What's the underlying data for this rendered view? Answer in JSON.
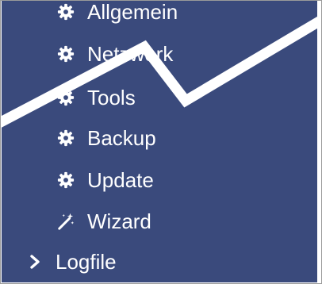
{
  "menu": {
    "items": [
      {
        "label": "Allgemein",
        "icon": "gear-icon"
      },
      {
        "label": "Netzwerk",
        "icon": "gear-icon"
      },
      {
        "label": "Tools",
        "icon": "gear-icon"
      },
      {
        "label": "Backup",
        "icon": "gear-icon"
      },
      {
        "label": "Update",
        "icon": "gear-icon"
      },
      {
        "label": "Wizard",
        "icon": "magic-wand-icon"
      },
      {
        "label": "Logfile",
        "icon": "chevron-right-icon"
      }
    ]
  },
  "colors": {
    "panel_background": "#3a4a7c",
    "text": "#ffffff",
    "overlay_line": "#ffffff"
  }
}
